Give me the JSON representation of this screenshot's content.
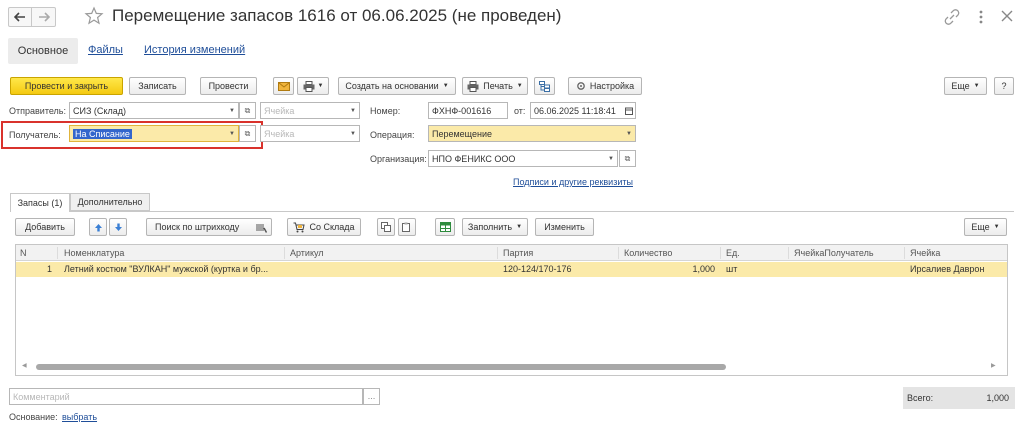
{
  "window": {
    "title": "Перемещение запасов 1616 от 06.06.2025 (не проведен)"
  },
  "nav_tabs": [
    "Основное",
    "Файлы",
    "История изменений"
  ],
  "toolbar": {
    "post_close": "Провести и закрыть",
    "save": "Записать",
    "post": "Провести",
    "create_based": "Создать на основании",
    "print": "Печать",
    "settings": "Настройка",
    "more": "Еще",
    "help": "?"
  },
  "form": {
    "sender_label": "Отправитель:",
    "sender_value": "СИЗ (Склад)",
    "sender_cell_placeholder": "Ячейка",
    "receiver_label": "Получатель:",
    "receiver_value": "На Списание",
    "receiver_cell_placeholder": "Ячейка",
    "number_label": "Номер:",
    "number_value": "ФХНФ-001616",
    "date_label": "от:",
    "date_value": "06.06.2025 11:18:41",
    "operation_label": "Операция:",
    "operation_value": "Перемещение",
    "org_label": "Организация:",
    "org_value": "НПО ФЕНИКС ООО",
    "signatures_link": "Подписи и другие реквизиты"
  },
  "inner_tabs": [
    "Запасы (1)",
    "Дополнительно"
  ],
  "table_toolbar": {
    "add": "Добавить",
    "barcode": "Поиск по штрихкоду",
    "from_warehouse": "Со Склада",
    "fill": "Заполнить",
    "change": "Изменить",
    "more": "Еще"
  },
  "table": {
    "columns": [
      "N",
      "Номенклатура",
      "Артикул",
      "Партия",
      "Количество",
      "Ед.",
      "ЯчейкаПолучатель",
      "Ячейка"
    ],
    "rows": [
      [
        "1",
        "Летний костюм \"ВУЛКАН\" мужской (куртка и бр...",
        "",
        "120-124/170-176",
        "1,000",
        "шт",
        "",
        "Ирсалиев Даврон"
      ]
    ]
  },
  "footer": {
    "comment_placeholder": "Комментарий",
    "total_label": "Всего:",
    "total_value": "1,000",
    "basis_label": "Основание:",
    "basis_link": "выбрать"
  },
  "colors": {
    "accent_yellow": "#f4c911",
    "selected_row": "#fbeaa9",
    "highlight_box": "#d9322c",
    "link": "#1f4e99"
  }
}
